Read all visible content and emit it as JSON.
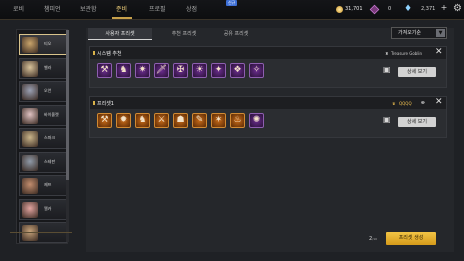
{
  "nav": {
    "items": [
      "로비",
      "챔피언",
      "보관함",
      "준비",
      "프로필",
      "상점"
    ],
    "active_index": 3,
    "new_badge": "신규"
  },
  "currency": {
    "coin_value": "31,701",
    "shard_value": "0",
    "gem_value": "2,371"
  },
  "heroes": [
    {
      "name": "티오",
      "selected": true,
      "color": "#c9a46b"
    },
    {
      "name": "벨라",
      "selected": false,
      "color": "#d9c49b"
    },
    {
      "name": "오언",
      "selected": false,
      "color": "#9aa0b3"
    },
    {
      "name": "바이올렛",
      "selected": false,
      "color": "#e0c3c3"
    },
    {
      "name": "스파크",
      "selected": false,
      "color": "#c9b58a"
    },
    {
      "name": "스테판",
      "selected": false,
      "color": "#8f9aa8"
    },
    {
      "name": "제프",
      "selected": false,
      "color": "#c28d6e"
    },
    {
      "name": "엘카",
      "selected": false,
      "color": "#e3a4a0"
    },
    {
      "name": "",
      "selected": false,
      "color": "#c7a37a"
    }
  ],
  "tabs": [
    "사용자 프리셋",
    "추천 프리셋",
    "공유 프리셋"
  ],
  "sort": {
    "label": "가져오기순"
  },
  "presets": [
    {
      "title": "시스템 추천",
      "tag": "Treasure Goblin",
      "detail_label": "상세 보기",
      "slots": [
        {
          "glyph": "⚒",
          "color": "purple"
        },
        {
          "glyph": "♞",
          "color": "purple"
        },
        {
          "glyph": "✷",
          "color": "purple"
        },
        {
          "glyph": "🗡",
          "color": "purple"
        },
        {
          "glyph": "✠",
          "color": "purple"
        },
        {
          "glyph": "☀",
          "color": "purple"
        },
        {
          "glyph": "✦",
          "color": "purple"
        },
        {
          "glyph": "❖",
          "color": "purple"
        },
        {
          "glyph": "✧",
          "color": "purple"
        }
      ]
    },
    {
      "title": "프리셋1",
      "tag": "QQQQ",
      "detail_label": "상세 보기",
      "slots": [
        {
          "glyph": "⚒",
          "color": "orange"
        },
        {
          "glyph": "✹",
          "color": "orange"
        },
        {
          "glyph": "♞",
          "color": "orange"
        },
        {
          "glyph": "⚔",
          "color": "orange"
        },
        {
          "glyph": "☗",
          "color": "orange"
        },
        {
          "glyph": "✎",
          "color": "orange"
        },
        {
          "glyph": "✶",
          "color": "orange"
        },
        {
          "glyph": "♨",
          "color": "orange"
        },
        {
          "glyph": "✺",
          "color": "purple"
        }
      ]
    }
  ],
  "footer": {
    "count": "2",
    "count_total": "/10",
    "create_label": "프리셋 생성"
  }
}
